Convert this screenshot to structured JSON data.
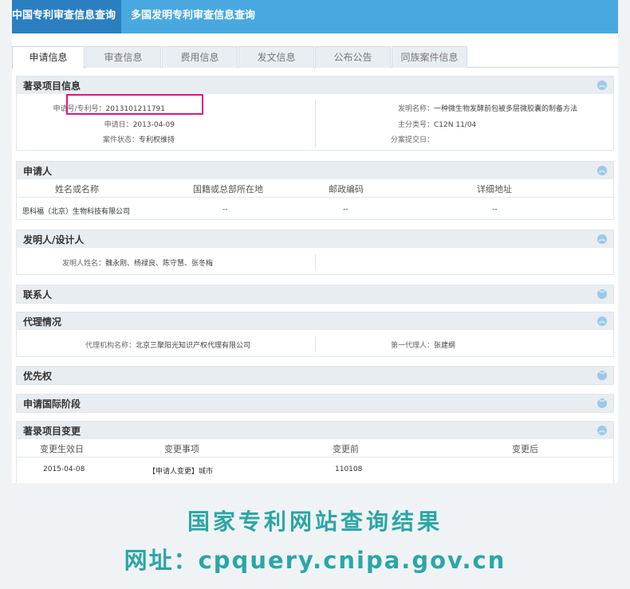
{
  "topnav": {
    "items": [
      "中国专利审查信息查询",
      "多国发明专利审查信息查询"
    ]
  },
  "tabs": [
    "申请信息",
    "审查信息",
    "费用信息",
    "发文信息",
    "公布公告",
    "同族案件信息"
  ],
  "biblio": {
    "title": "著录项目信息",
    "app_no_label": "申请号/专利号：",
    "app_no": "2013101211791",
    "app_date_label": "申请日：",
    "app_date": "2013-04-09",
    "status_label": "案件状态：",
    "status": "专利权维持",
    "invention_name_label": "发明名称：",
    "invention_name": "一种微生物发酵前包被多层微胶囊的制备方法",
    "main_class_label": "主分类号：",
    "main_class": "C12N 11/04",
    "divisional_label": "分案提交日：",
    "divisional": ""
  },
  "applicant": {
    "title": "申请人",
    "columns": [
      "姓名或名称",
      "国籍或总部所在地",
      "邮政编码",
      "详细地址"
    ],
    "row": [
      "思科福（北京）生物科技有限公司",
      "--",
      "--",
      "--"
    ]
  },
  "inventor": {
    "title": "发明人/设计人",
    "label": "发明人姓名：",
    "value": "魏永刚、杨禄良、陈守慧、张冬梅"
  },
  "contact": {
    "title": "联系人"
  },
  "agency": {
    "title": "代理情况",
    "org_label": "代理机构名称：",
    "org": "北京三聚阳光知识产权代理有限公司",
    "agent_label": "第一代理人：",
    "agent": "张建纲"
  },
  "priority": {
    "title": "优先权"
  },
  "intl": {
    "title": "申请国际阶段"
  },
  "changes": {
    "title": "著录项目变更",
    "columns": [
      "变更生效日",
      "变更事项",
      "变更前",
      "变更后"
    ],
    "row": [
      "2015-04-08",
      "【申请人变更】城市",
      "110108",
      ""
    ]
  },
  "footer": {
    "title": "国家专利网站查询结果",
    "url": "网址：cpquery.cnipa.gov.cn"
  },
  "colors": {
    "nav": "#4aa8e0",
    "nav_active": "#2b7fc1",
    "highlight": "#e0157a",
    "footer": "#2ba6a6"
  }
}
